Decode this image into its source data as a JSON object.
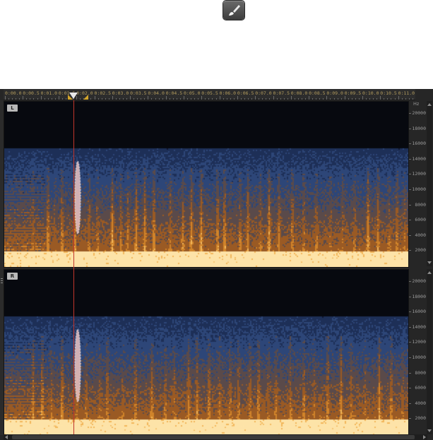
{
  "toolbar": {
    "brush_tool_icon": "paintbrush-icon"
  },
  "ruler": {
    "labels": [
      "0:00.0",
      "0:00.5",
      "0:01.0",
      "0:01.5",
      "0:02.0",
      "0:02.5",
      "0:03.0",
      "0:03.5",
      "0:04.0",
      "0:04.5",
      "0:05.0",
      "0:05.5",
      "0:06.0",
      "0:06.5",
      "0:07.0",
      "0:07.5",
      "0:08.0",
      "0:08.5",
      "0:09.0",
      "0:09.5",
      "0:10.0",
      "0:10.5",
      "0:11.0"
    ]
  },
  "channels": [
    {
      "label": "L"
    },
    {
      "label": "R"
    }
  ],
  "frequency_scale": {
    "unit": "Hz",
    "labels": [
      "20000",
      "18000",
      "16000",
      "14000",
      "12000",
      "10000",
      "8000",
      "6000",
      "4000",
      "2000"
    ]
  },
  "colors": {
    "editor_bg": "#262626",
    "playhead": "#c0352c",
    "ruler_label": "#b19a5c",
    "selection_marker": "#d2a42a",
    "spectrogram_low": "#0a0d1a",
    "spectrogram_mid": "#233a66",
    "spectrogram_high": "#d98a2c"
  }
}
